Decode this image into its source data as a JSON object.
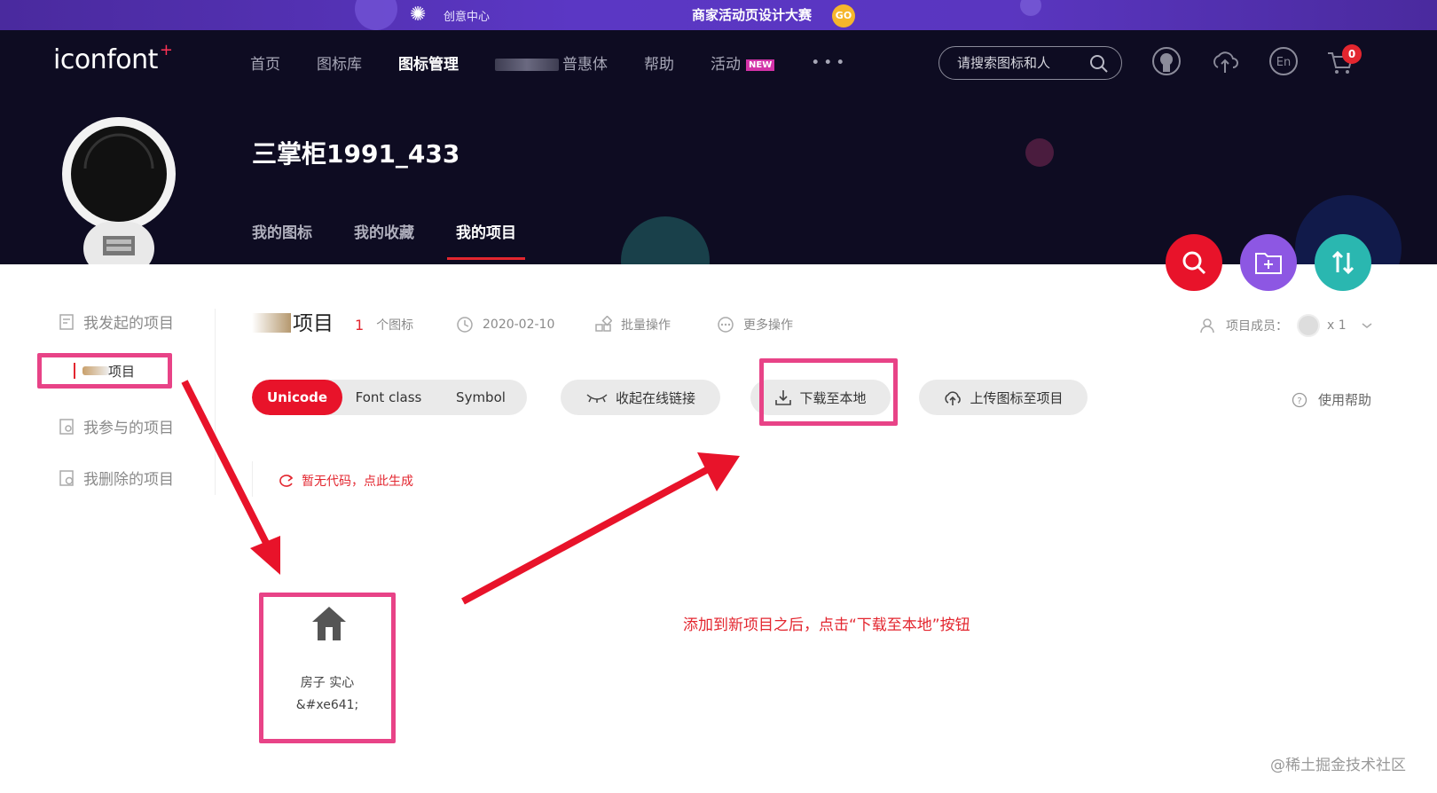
{
  "promo": {
    "left_text": "创意中心",
    "right_text": "商家活动页设计大赛",
    "go": "GO"
  },
  "header": {
    "logo": "iconfont",
    "logo_plus": "+",
    "nav": {
      "home": "首页",
      "library": "图标库",
      "manage": "图标管理",
      "font_suffix": "普惠体",
      "help": "帮助",
      "activity": "活动",
      "new_badge": "NEW",
      "more": "•••"
    },
    "search_placeholder": "请搜索图标和人",
    "cart_count": "0",
    "username": "三掌柜1991_433",
    "tabs": {
      "my_icons": "我的图标",
      "my_favorites": "我的收藏",
      "my_projects": "我的项目"
    }
  },
  "sidebar": {
    "initiated": "我发起的项目",
    "current_project": "项目",
    "participated": "我参与的项目",
    "deleted": "我删除的项目"
  },
  "project": {
    "title": "项目",
    "icon_count": "1",
    "icon_count_unit": "个图标",
    "date": "2020-02-10",
    "batch": "批量操作",
    "more_ops": "更多操作",
    "members_label": "项目成员：",
    "members_count": "x 1"
  },
  "toolbar": {
    "seg_unicode": "Unicode",
    "seg_fontclass": "Font class",
    "seg_symbol": "Symbol",
    "online_link": "收起在线链接",
    "download": "下载至本地",
    "upload": "上传图标至项目",
    "help": "使用帮助"
  },
  "generate_code": "暂无代码，点此生成",
  "icon_card": {
    "icon": "house-filled-icon",
    "name": "房子 实心",
    "code": "&#xe641;"
  },
  "annotation": "添加到新项目之后，点击“下载至本地”按钮",
  "watermark": "@稀土掘金技术社区",
  "colors": {
    "accent": "#e8132a",
    "highlight": "#e84387",
    "header_bg": "#0e0c22",
    "fab_purple": "#8d57e3",
    "fab_teal": "#2ab7b0"
  }
}
